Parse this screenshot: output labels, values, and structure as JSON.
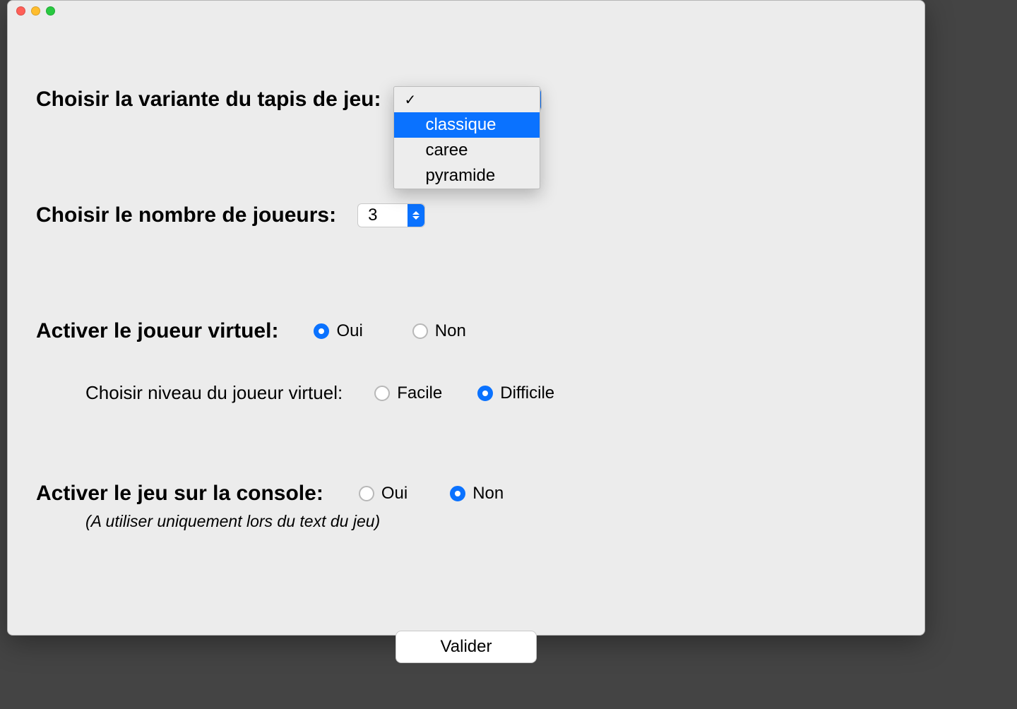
{
  "variant": {
    "label": "Choisir la variante du tapis de jeu:",
    "selected": "",
    "options": [
      "",
      "classique",
      "caree",
      "pyramide"
    ],
    "highlighted": "classique"
  },
  "players": {
    "label": "Choisir le nombre de joueurs:",
    "value": "3"
  },
  "virtual": {
    "label": "Activer le joueur virtuel:",
    "yes": "Oui",
    "no": "Non",
    "selected": "Oui",
    "difficulty_label": "Choisir niveau du joueur virtuel:",
    "easy": "Facile",
    "hard": "Difficile",
    "difficulty_selected": "Difficile"
  },
  "console": {
    "label": "Activer le jeu sur la console:",
    "yes": "Oui",
    "no": "Non",
    "selected": "Non",
    "hint": "(A utiliser uniquement lors du text du jeu)"
  },
  "validate_label": "Valider"
}
